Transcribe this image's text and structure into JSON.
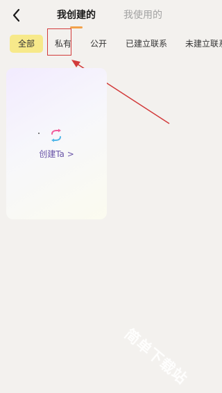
{
  "header": {
    "back_icon": "chevron-left-icon",
    "tabs": [
      {
        "label": "我创建的",
        "active": true
      },
      {
        "label": "我使用的",
        "active": false
      }
    ],
    "indicator_color": "#f2a14a"
  },
  "filters": {
    "selected_bg": "#f7e98a",
    "items": [
      {
        "label": "全部",
        "selected": true
      },
      {
        "label": "私有",
        "selected": false
      },
      {
        "label": "公开",
        "selected": false
      },
      {
        "label": "已建立联系",
        "selected": false
      },
      {
        "label": "未建立联系",
        "selected": false
      }
    ]
  },
  "annotation": {
    "color": "#d23a3a"
  },
  "card": {
    "icon": "sync-arrows-icon",
    "label": "创建Ta >"
  },
  "watermark": {
    "text": "简单下载站"
  }
}
